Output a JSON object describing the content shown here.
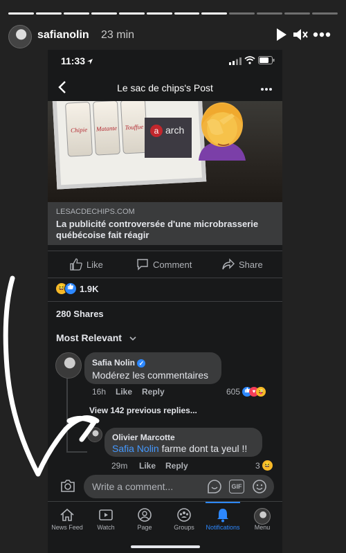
{
  "story": {
    "username": "safianolin",
    "time": "23 min",
    "progress_total": 12,
    "progress_done": 8
  },
  "phone": {
    "status_time": "11:33",
    "nav_title": "Le sac de chips's Post",
    "preview": {
      "cans": [
        "Chipie",
        "Matante",
        "Touffue"
      ],
      "brand": "arch"
    },
    "link": {
      "domain": "LESACDECHIPS.COM",
      "title": "La publicité controversée d'une microbrasserie québécoise fait réagir"
    },
    "actions": {
      "like": "Like",
      "comment": "Comment",
      "share": "Share"
    },
    "reaction_count": "1.9K",
    "shares": "280 Shares",
    "most_relevant": "Most Relevant",
    "comment1": {
      "name": "Safia Nolin",
      "text": "Modérez les commentaires",
      "time": "16h",
      "like": "Like",
      "reply": "Reply",
      "count": "605"
    },
    "view_replies": "View 142 previous replies...",
    "comment2": {
      "name": "Olivier Marcotte",
      "mention": "Safia Nolin",
      "text": " farme dont ta yeul !!",
      "time": "29m",
      "like": "Like",
      "reply": "Reply",
      "count": "3"
    },
    "comment_placeholder": "Write a comment...",
    "gif_label": "GIF",
    "tabs": [
      {
        "label": "News Feed",
        "icon": "home-icon"
      },
      {
        "label": "Watch",
        "icon": "watch-icon"
      },
      {
        "label": "Page",
        "icon": "page-icon"
      },
      {
        "label": "Groups",
        "icon": "groups-icon"
      },
      {
        "label": "Notifications",
        "icon": "bell-icon"
      },
      {
        "label": "Menu",
        "icon": "menu-icon"
      }
    ],
    "active_tab": "Notifications",
    "accent_color": "#2d88ff"
  }
}
